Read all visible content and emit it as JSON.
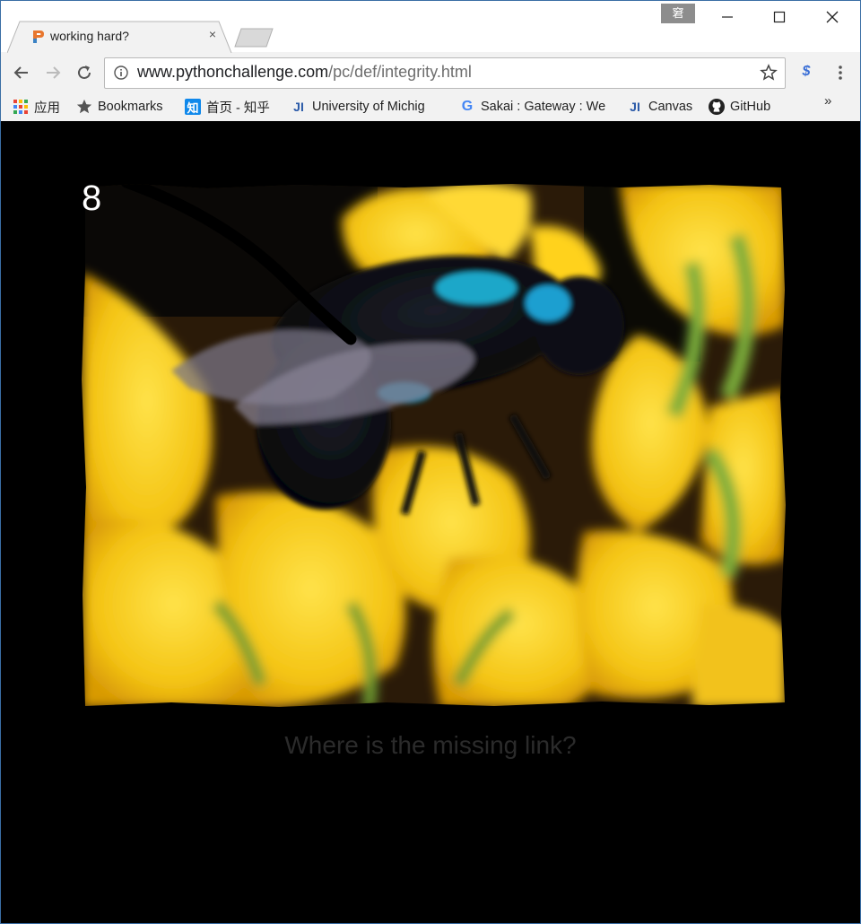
{
  "window": {
    "profile_badge": "窘",
    "controls": [
      "minimize",
      "maximize",
      "close"
    ]
  },
  "tab": {
    "title": "working hard?",
    "favicon": "python-challenge-icon",
    "close": "×"
  },
  "toolbar": {
    "url_host": "www.pythonchallenge.com",
    "url_path": "/pc/def/integrity.html"
  },
  "bookmarks": {
    "items": [
      {
        "label": "应用",
        "icon": "apps-grid-icon"
      },
      {
        "label": "Bookmarks",
        "icon": "star-icon"
      },
      {
        "label": "首页 - 知乎",
        "icon": "zhihu-icon",
        "icon_text": "知"
      },
      {
        "label": "University of Michig",
        "icon": "ji-icon",
        "icon_text": "JI"
      },
      {
        "label": "Sakai : Gateway : We",
        "icon": "google-icon",
        "icon_text": "G"
      },
      {
        "label": "Canvas",
        "icon": "ji-icon",
        "icon_text": "JI"
      },
      {
        "label": "GitHub",
        "icon": "github-icon"
      }
    ],
    "more": "»"
  },
  "page": {
    "level_number": "8",
    "caption": "Where is the missing link?",
    "image_subject": "bee-on-yellow-flowers"
  },
  "colors": {
    "background": "#000000",
    "caption": "#2b2b2b",
    "flower_yellow": "#f5c518",
    "bee_blue": "#1aa7c9"
  }
}
